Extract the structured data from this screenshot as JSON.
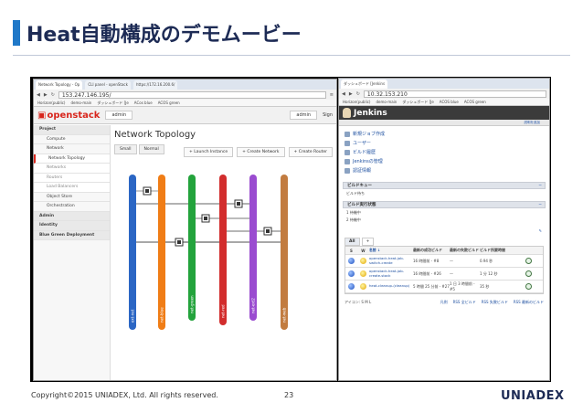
{
  "slide": {
    "title": "Heat自動構成のデモムービー",
    "copyright": "Copyright©2015 UNIADEX, Ltd. All rights reserved.",
    "page_number": "23",
    "logo": "UNIADEX",
    "accent_color": "#1f78c8",
    "title_color": "#1d2b55"
  },
  "openstack": {
    "tabs": [
      "Network Topology - Op",
      "CLI panel - openStack",
      "https://172.16.200.6/"
    ],
    "url": "153.247.146.195/",
    "bookmarks": [
      "Horizon(public)",
      "demo-main",
      "ダッシュボード [Je",
      "ACos blue",
      "ACOS green"
    ],
    "logo": "openstack",
    "project": "admin",
    "user": "admin",
    "sign_out": "Sign",
    "sidebar": [
      {
        "label": "Project",
        "level": 1
      },
      {
        "label": "Compute",
        "level": 2
      },
      {
        "label": "Network",
        "level": 2
      },
      {
        "label": "Network Topology",
        "level": 3,
        "selected": true
      },
      {
        "label": "Networks",
        "level": 3
      },
      {
        "label": "Routers",
        "level": 3
      },
      {
        "label": "Load Balancers",
        "level": 3
      },
      {
        "label": "Object Store",
        "level": 2
      },
      {
        "label": "Orchestration",
        "level": 2
      },
      {
        "label": "Admin",
        "level": 1
      },
      {
        "label": "Identity",
        "level": 1
      },
      {
        "label": "Blue Green Deployment",
        "level": 1
      }
    ],
    "page_title": "Network Topology",
    "view_buttons": [
      "Small",
      "Normal"
    ],
    "action_buttons": [
      "+ Launch Instance",
      "+ Create Network",
      "+ Create Router"
    ],
    "network_colors": [
      "#2b66c4",
      "#f07d16",
      "#23a33c",
      "#d22d2d",
      "#9a4cd0",
      "#c27c40"
    ],
    "network_labels": [
      "ext-net",
      "net-blue",
      "net-green",
      "net-red",
      "net-ext2",
      "net-web"
    ]
  },
  "jenkins": {
    "tab": "ダッシュボード [Jenkins",
    "url": "10.32.153.210",
    "bookmarks": [
      "Horizon(public)",
      "demo-main",
      "ダッシュボード [Je",
      "ACOS blue",
      "ACOS green"
    ],
    "title": "Jenkins",
    "top_right": "説明を追加",
    "menu": [
      "新規ジョブ作成",
      "ユーザー",
      "ビルド履歴",
      "Jenkinsの管理",
      "認証情報"
    ],
    "queue_header": "ビルドキュー",
    "queue_text": "ビルド待ち",
    "executors_header": "ビルド実行状態",
    "executors": [
      "1 待機中",
      "2 待機中"
    ],
    "views": [
      "All",
      "+"
    ],
    "columns": [
      "S",
      "W",
      "名前 ↓",
      "最新の成功ビルド",
      "最新の失敗ビルド",
      "ビルド所要時間"
    ],
    "jobs": [
      {
        "name": "openstack-heat-job-switch-create",
        "last_success": "16 時間前 - #8",
        "last_failure": "—",
        "duration": "0.94 秒",
        "status": "blue",
        "weather": "sunny"
      },
      {
        "name": "openstack-heat-job-create-stack",
        "last_success": "16 時間前 - #26",
        "last_failure": "—",
        "duration": "1 分 12 秒",
        "status": "blue",
        "weather": "sunny"
      },
      {
        "name": "heat-cleanup-(cleanup)",
        "last_success": "5 時間 25 分前 - #27",
        "last_failure": "1 日 3 時間前 - #5",
        "duration": "35 秒",
        "status": "blue",
        "weather": "sunny"
      }
    ],
    "icon_label": "アイコン: S M L",
    "legend": "凡例",
    "feeds": [
      "RSS 全ビルド",
      "RSS 失敗ビルド",
      "RSS 最新のビルド"
    ],
    "legend_link": "凡例"
  }
}
